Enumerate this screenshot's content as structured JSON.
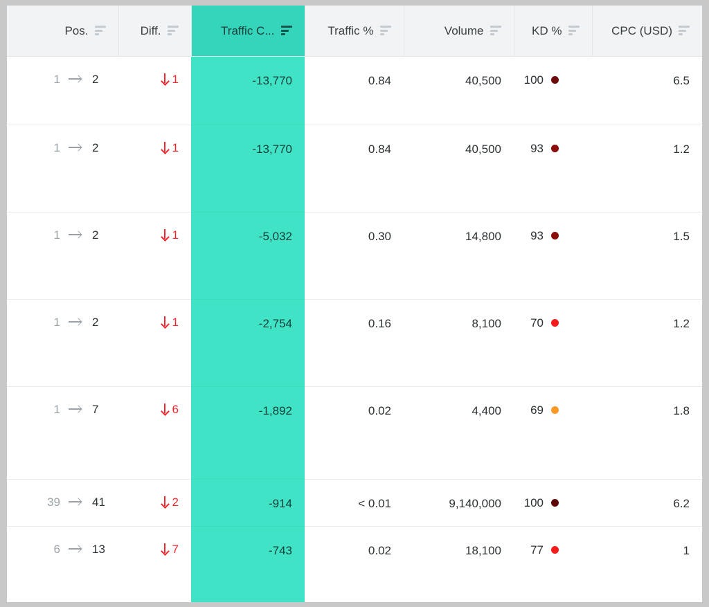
{
  "table": {
    "columns": [
      {
        "key": "pos",
        "label": "Pos.",
        "sorted": false,
        "icon": "sort-icon"
      },
      {
        "key": "diff",
        "label": "Diff.",
        "sorted": false,
        "icon": "sort-icon"
      },
      {
        "key": "tc",
        "label": "Traffic C...",
        "sorted": true,
        "icon": "sort-icon"
      },
      {
        "key": "tpct",
        "label": "Traffic %",
        "sorted": false,
        "icon": "sort-icon"
      },
      {
        "key": "vol",
        "label": "Volume",
        "sorted": false,
        "icon": "sort-icon"
      },
      {
        "key": "kd",
        "label": "KD %",
        "sorted": false,
        "icon": "sort-icon"
      },
      {
        "key": "cpc",
        "label": "CPC (USD)",
        "sorted": false,
        "icon": "sort-icon"
      }
    ],
    "rows": [
      {
        "pos_from": "1",
        "pos_to": "2",
        "diff": "1",
        "diff_dir": "down",
        "traffic_change": "-13,770",
        "traffic_pct": "0.84",
        "volume": "40,500",
        "kd": "100",
        "kd_color": "#6d0a0a",
        "cpc": "6.5"
      },
      {
        "pos_from": "1",
        "pos_to": "2",
        "diff": "1",
        "diff_dir": "down",
        "traffic_change": "-13,770",
        "traffic_pct": "0.84",
        "volume": "40,500",
        "kd": "93",
        "kd_color": "#8c0b0b",
        "cpc": "1.2"
      },
      {
        "pos_from": "1",
        "pos_to": "2",
        "diff": "1",
        "diff_dir": "down",
        "traffic_change": "-5,032",
        "traffic_pct": "0.30",
        "volume": "14,800",
        "kd": "93",
        "kd_color": "#8c0b0b",
        "cpc": "1.5"
      },
      {
        "pos_from": "1",
        "pos_to": "2",
        "diff": "1",
        "diff_dir": "down",
        "traffic_change": "-2,754",
        "traffic_pct": "0.16",
        "volume": "8,100",
        "kd": "70",
        "kd_color": "#f61c1c",
        "cpc": "1.2"
      },
      {
        "pos_from": "1",
        "pos_to": "7",
        "diff": "6",
        "diff_dir": "down",
        "traffic_change": "-1,892",
        "traffic_pct": "0.02",
        "volume": "4,400",
        "kd": "69",
        "kd_color": "#f99a26",
        "cpc": "1.8"
      },
      {
        "pos_from": "39",
        "pos_to": "41",
        "diff": "2",
        "diff_dir": "down",
        "traffic_change": "-914",
        "traffic_pct": "< 0.01",
        "volume": "9,140,000",
        "kd": "100",
        "kd_color": "#5e0606",
        "cpc": "6.2"
      },
      {
        "pos_from": "6",
        "pos_to": "13",
        "diff": "7",
        "diff_dir": "down",
        "traffic_change": "-743",
        "traffic_pct": "0.02",
        "volume": "18,100",
        "kd": "77",
        "kd_color": "#f61c1c",
        "cpc": "1"
      }
    ]
  },
  "theme": {
    "sorted_header_bg": "#34d5bb",
    "sorted_cell_bg": "#41e3c7",
    "header_bg": "#f1f3f4",
    "negative_color": "#f5252d",
    "page_bg": "#c8c8c8"
  }
}
